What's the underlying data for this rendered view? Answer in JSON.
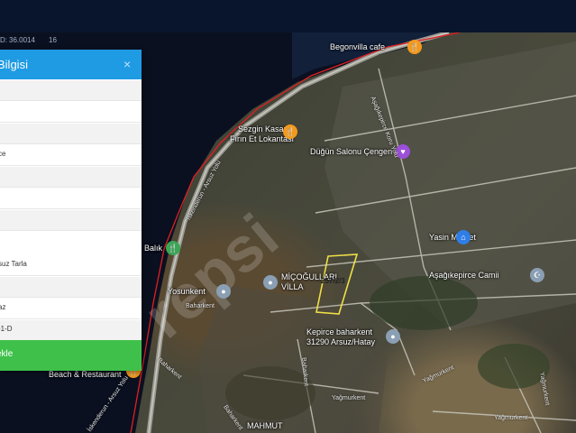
{
  "coords": {
    "value_a": "36.0014",
    "value_b": "16",
    "prefix": "D:"
  },
  "panel": {
    "title": "Bilgisi",
    "close_label": "×",
    "rows": [
      "",
      "",
      "",
      "ce",
      "",
      "",
      "",
      "suz Tarla",
      "",
      "az",
      "-1-D"
    ],
    "add_label": "ekle"
  },
  "map": {
    "pois": [
      {
        "name": "Begonvilla cafe",
        "icon": "restaurant-icon",
        "color": "#f39a1e"
      },
      {
        "name": "Sezgin Kasap Fırın Et Lokantası",
        "line1": "Sezgin Kasap",
        "line2": "Fırın Et Lokantası",
        "icon": "restaurant-icon",
        "color": "#f39a1e"
      },
      {
        "name": "Düğün Salonu Çengen",
        "icon": "event-venue-icon",
        "color": "#9c4fd8"
      },
      {
        "name": "Yasin Market",
        "icon": "shop-icon",
        "color": "#2f7ee8"
      },
      {
        "name": "Aşağıkepirce Camii",
        "icon": "mosque-icon",
        "color": "#8a9fb3"
      },
      {
        "name": "Balık",
        "icon": "fish-restaurant-icon",
        "color": "#3aa656"
      },
      {
        "name": "Yosunkent",
        "icon": "place-icon",
        "color": "#8a9fb3"
      },
      {
        "name": "MİÇOĞULLARI VİLLA",
        "line1": "MİÇOĞULLARI",
        "line2": "VİLLA",
        "icon": "place-icon",
        "color": "#8a9fb3"
      },
      {
        "name": "Kepirce baharkent 31290 Arsuz/Hatay",
        "line1": "Kepirce baharkent",
        "line2": "31290 Arsuz/Hatay",
        "icon": "place-icon",
        "color": "#8a9fb3"
      },
      {
        "name": "Beach & Restaurant",
        "icon": "restaurant-icon",
        "color": "#f39a1e"
      },
      {
        "name": "MAHMUT",
        "icon": "place-icon",
        "color": "#8a9fb3"
      }
    ],
    "roads": [
      "Aşağıkepirce Koru Yolu",
      "İskenderun - Arsuz Yolu",
      "Baharkent",
      "Baharkent",
      "Baharkent",
      "Baharkent",
      "Yağmurkent",
      "Yağmurkent",
      "Yağmurkent",
      "Yağmurkent",
      "İskenderun - Arsuz Yolu"
    ],
    "parcel_label": "257/2/3",
    "parcel_color": "#f0e046",
    "boundary_color": "#e02020",
    "watermark": "repsi"
  }
}
